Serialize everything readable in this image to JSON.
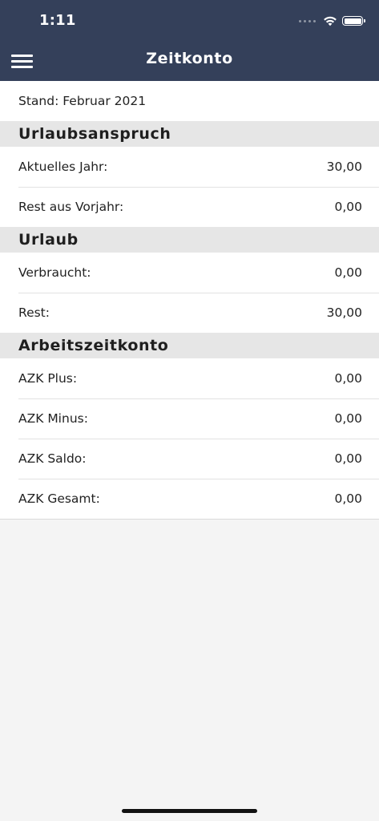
{
  "status": {
    "time": "1:11"
  },
  "nav": {
    "title": "Zeitkonto"
  },
  "stand": "Stand: Februar 2021",
  "sections": [
    {
      "title": "Urlaubsanspruch",
      "rows": [
        {
          "label": "Aktuelles Jahr:",
          "value": "30,00"
        },
        {
          "label": "Rest aus Vorjahr:",
          "value": "0,00"
        }
      ]
    },
    {
      "title": "Urlaub",
      "rows": [
        {
          "label": "Verbraucht:",
          "value": "0,00"
        },
        {
          "label": "Rest:",
          "value": "30,00"
        }
      ]
    },
    {
      "title": "Arbeitszeitkonto",
      "rows": [
        {
          "label": "AZK Plus:",
          "value": "0,00"
        },
        {
          "label": "AZK Minus:",
          "value": "0,00"
        },
        {
          "label": "AZK Saldo:",
          "value": "0,00"
        },
        {
          "label": "AZK Gesamt:",
          "value": "0,00"
        }
      ]
    }
  ],
  "colors": {
    "header_background": "#34405a",
    "section_background": "#e6e6e6",
    "page_background": "#f4f4f4"
  },
  "icons": {
    "menu": "hamburger-menu-icon",
    "wifi": "wifi-icon",
    "battery": "battery-icon",
    "cellular": "cellular-signal-icon"
  }
}
